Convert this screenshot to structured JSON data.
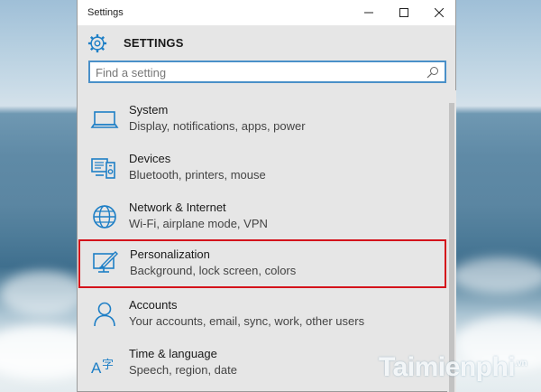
{
  "window": {
    "title": "Settings",
    "controls": [
      "minimize-icon",
      "maximize-icon",
      "close-icon"
    ]
  },
  "header": {
    "title": "SETTINGS",
    "icon": "gear-icon"
  },
  "search": {
    "placeholder": "Find a setting",
    "value": ""
  },
  "items": [
    {
      "title": "System",
      "subtitle": "Display, notifications, apps, power",
      "icon": "laptop-icon"
    },
    {
      "title": "Devices",
      "subtitle": "Bluetooth, printers, mouse",
      "icon": "devices-icon"
    },
    {
      "title": "Network & Internet",
      "subtitle": "Wi-Fi, airplane mode, VPN",
      "icon": "globe-icon"
    },
    {
      "title": "Personalization",
      "subtitle": "Background, lock screen, colors",
      "icon": "paint-icon",
      "highlighted": true
    },
    {
      "title": "Accounts",
      "subtitle": "Your accounts, email, sync, work, other users",
      "icon": "person-icon"
    },
    {
      "title": "Time & language",
      "subtitle": "Speech, region, date",
      "icon": "time-language-icon"
    }
  ],
  "colors": {
    "accent": "#1e7fc6",
    "highlight": "#d4131b"
  },
  "watermark": {
    "text": "Taimienphi",
    "suffix": ".vn"
  }
}
